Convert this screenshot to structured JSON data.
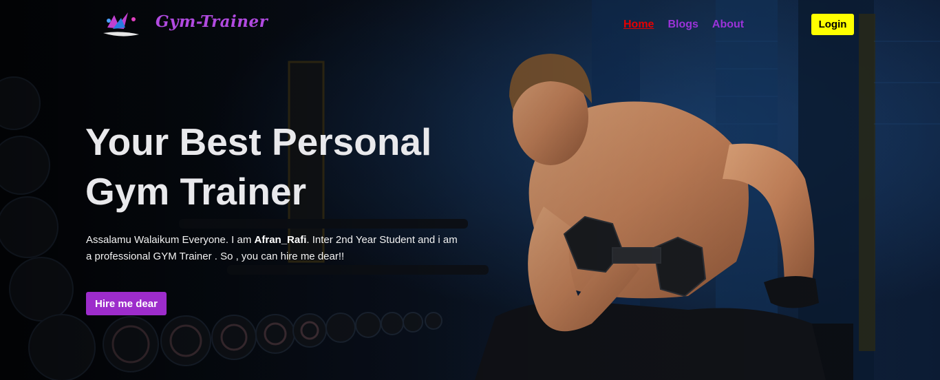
{
  "navbar": {
    "brand": "Gym-Trainer",
    "links": [
      {
        "label": "Home",
        "active": true
      },
      {
        "label": "Blogs",
        "active": false
      },
      {
        "label": "About",
        "active": false
      }
    ],
    "login_label": "Login"
  },
  "hero": {
    "headline_line1": "Your Best Personal",
    "headline_line2": "Gym Trainer",
    "intro_before": "Assalamu Walaikum Everyone. I am ",
    "intro_name": "Afran_Rafi",
    "intro_after": ". Inter 2nd Year Student and i am a professional GYM Trainer . So , you can hire me dear!!",
    "cta_label": "Hire me dear",
    "image": "gym-trainer-with-dumbbell"
  },
  "colors": {
    "brand": "#b14ae0",
    "nav_link": "#9b33d9",
    "nav_active": "#e60000",
    "login_bg": "#ffff00",
    "cta_bg": "#9d2ccb"
  }
}
